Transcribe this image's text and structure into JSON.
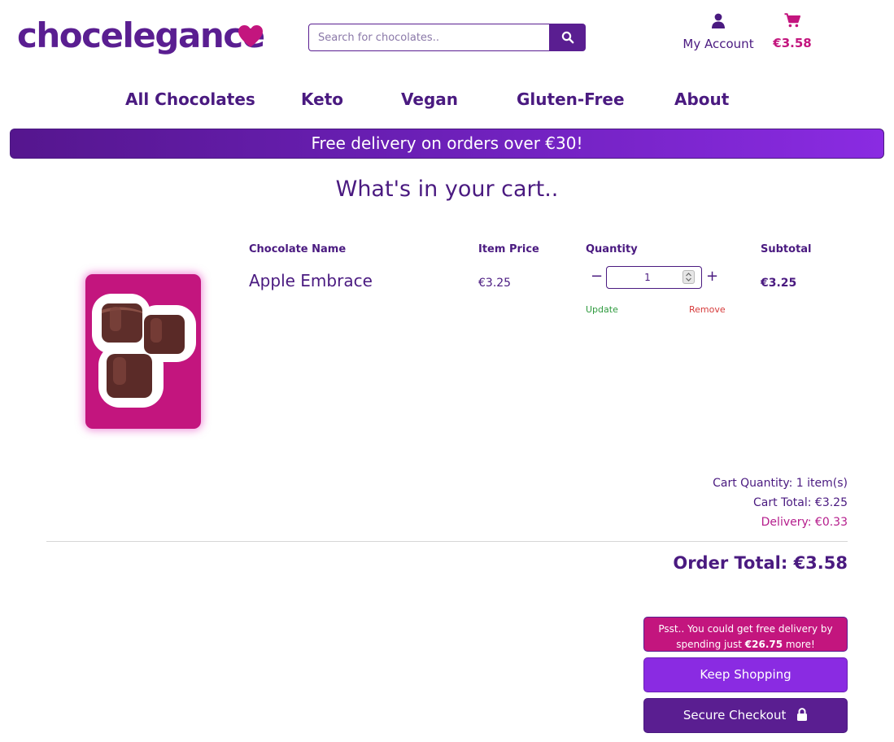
{
  "header": {
    "logo_text": "chocelegance",
    "search_placeholder": "Search for chocolates..",
    "account_label": "My Account",
    "cart_total": "€3.58"
  },
  "nav": {
    "items": [
      "All Chocolates",
      "Keto",
      "Vegan",
      "Gluten-Free",
      "About"
    ]
  },
  "banner": {
    "text": "Free delivery on orders over €30!"
  },
  "cart": {
    "title": "What's in your cart..",
    "columns": {
      "name": "Chocolate Name",
      "price": "Item Price",
      "quantity": "Quantity",
      "subtotal": "Subtotal"
    },
    "items": [
      {
        "name": "Apple Embrace",
        "price": "€3.25",
        "quantity": "1",
        "update": "Update",
        "remove": "Remove",
        "subtotal": "€3.25"
      }
    ]
  },
  "summary": {
    "cart_quantity": "Cart Quantity: 1 item(s)",
    "cart_total": "Cart Total: €3.25",
    "delivery": "Delivery: €0.33",
    "order_total": "Order Total: €3.58"
  },
  "actions": {
    "psst_prefix": "Psst.. You could get free delivery by spending just ",
    "psst_amount": "€26.75",
    "psst_suffix": " more!",
    "keep_shopping": "Keep Shopping",
    "secure_checkout": "Secure Checkout"
  },
  "colors": {
    "brand_purple": "#5a1e91",
    "accent_magenta": "#c3157e",
    "banner_end": "#8a2be2",
    "update_green": "#2e9a3e",
    "remove_red": "#d63b3b"
  },
  "icons": [
    "heart-icon",
    "search-icon",
    "user-icon",
    "cart-icon",
    "lock-icon"
  ]
}
